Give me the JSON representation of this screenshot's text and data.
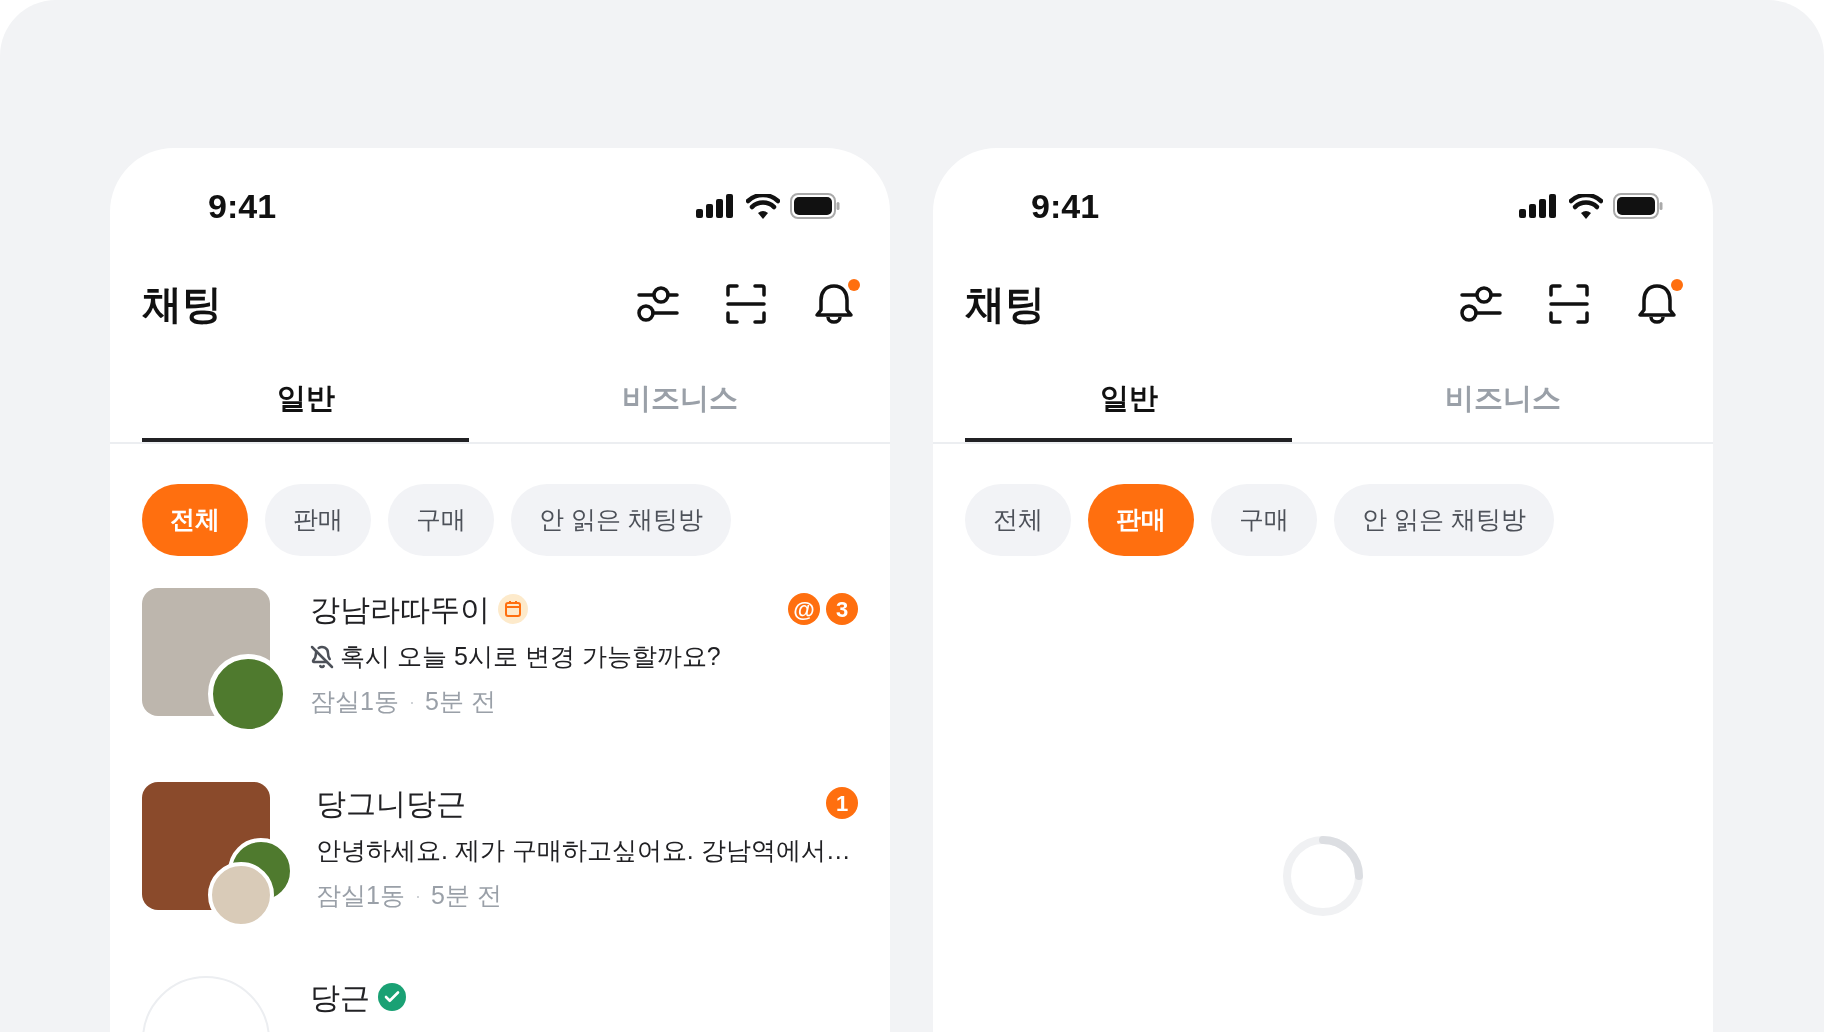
{
  "phones": [
    {
      "status": {
        "time": "9:41"
      },
      "title": "채팅",
      "notification_dot": true,
      "tabs": [
        {
          "label": "일반",
          "selected": true
        },
        {
          "label": "비즈니스",
          "selected": false
        }
      ],
      "filters": [
        {
          "label": "전체",
          "selected": true
        },
        {
          "label": "판매",
          "selected": false
        },
        {
          "label": "구매",
          "selected": false
        },
        {
          "label": "안 읽은 채팅방",
          "selected": false
        }
      ],
      "chats": [
        {
          "kind": "single",
          "name": "강남라따뚜이",
          "name_badge": {
            "kind": "calendar"
          },
          "muted": true,
          "message": "혹시 오늘 5시로 변경 가능할까요?",
          "location": "잠실1동",
          "separator": "·",
          "time": "5분 전",
          "mention": "@",
          "unread": "3"
        },
        {
          "kind": "pair",
          "name": "당그니당근",
          "muted": false,
          "message": "안녕하세요. 제가 구매하고싶어요. 강남역에서…",
          "location": "잠실1동",
          "separator": "·",
          "time": "5분 전",
          "unread": "1"
        },
        {
          "kind": "plain",
          "name": "당근",
          "name_badge": {
            "kind": "verified"
          }
        }
      ]
    },
    {
      "status": {
        "time": "9:41"
      },
      "title": "채팅",
      "notification_dot": true,
      "tabs": [
        {
          "label": "일반",
          "selected": true
        },
        {
          "label": "비즈니스",
          "selected": false
        }
      ],
      "filters": [
        {
          "label": "전체",
          "selected": false
        },
        {
          "label": "판매",
          "selected": true
        },
        {
          "label": "구매",
          "selected": false
        },
        {
          "label": "안 읽은 채팅방",
          "selected": false
        }
      ],
      "loading": true
    }
  ]
}
